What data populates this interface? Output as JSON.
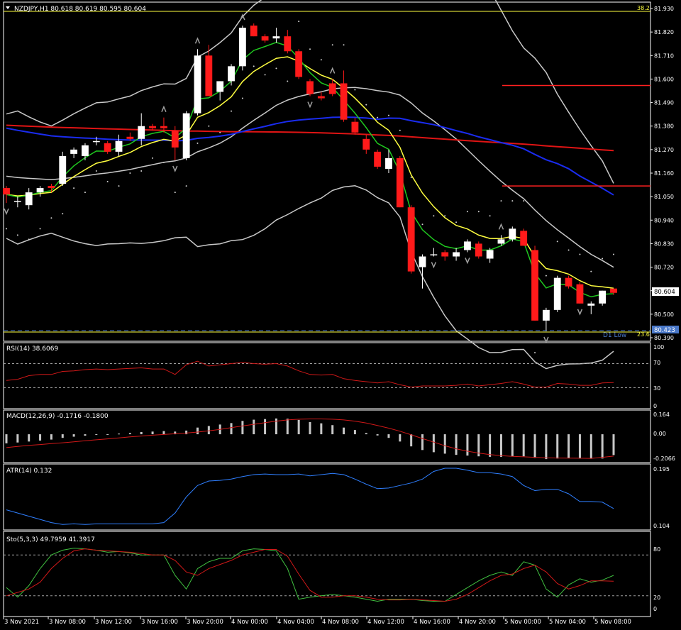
{
  "colors": {
    "bg": "#000000",
    "frame": "#ffffff",
    "text": "#ffffff",
    "bull": "#ffffff",
    "bear": "#ff1a1a",
    "ema_fast": "#1fc81f",
    "ema_slow": "#ffff40",
    "sma_blue": "#1a2cf0",
    "sma_red": "#e01414",
    "bands": "#c8c8c8",
    "psar": "#d0d0d0",
    "fib": "#ffff40",
    "resist": "#ff2020",
    "low_line": "#4a78c8",
    "rsi": "#d01818",
    "macd_hist": "#c8c8c8",
    "macd_signal": "#d01818",
    "atr": "#2f7fff",
    "sto_main": "#40c040",
    "sto_signal": "#d01818",
    "level_dash": "#a0a0a0",
    "price_tag_bg": "#ffffff",
    "low_tag_bg": "#4a78c8"
  },
  "main": {
    "header": "NZDJPY,H1  80.618 80.619 80.595 80.604",
    "price_ticks": [
      "81.930",
      "81.820",
      "81.710",
      "81.600",
      "81.490",
      "81.380",
      "81.270",
      "81.160",
      "81.050",
      "80.940",
      "80.830",
      "80.720",
      "80.610",
      "80.500",
      "80.390"
    ],
    "current_price": "80.604",
    "low_price": "80.423",
    "low_label": "D1 Low",
    "fib_top_label": "38.2",
    "fib_bottom_label": "23.6"
  },
  "rsi": {
    "label": "RSI(14) 38.6069",
    "scale": [
      "100",
      "70",
      "30",
      "0"
    ]
  },
  "macd": {
    "label": "MACD(12,26,9) -0.1716 -0.1800",
    "scale": [
      "0.164",
      "0.00",
      "-0.2066"
    ]
  },
  "atr": {
    "label": "ATR(14) 0.132",
    "scale": [
      "0.195",
      "0.104"
    ]
  },
  "sto": {
    "label": "Sto(5,3,3) 49.7959 41.3917",
    "scale": [
      "80",
      "20",
      "0"
    ]
  },
  "time_axis": [
    "3 Nov 2021",
    "3 Nov 08:00",
    "3 Nov 12:00",
    "3 Nov 16:00",
    "3 Nov 20:00",
    "4 Nov 00:00",
    "4 Nov 04:00",
    "4 Nov 08:00",
    "4 Nov 12:00",
    "4 Nov 16:00",
    "4 Nov 20:00",
    "5 Nov 00:00",
    "5 Nov 04:00",
    "5 Nov 08:00"
  ],
  "chart_data": [
    {
      "type": "candlestick",
      "title": "NZDJPY,H1",
      "ylim": [
        80.39,
        81.95
      ],
      "candles": [
        [
          81.09,
          81.1,
          81.02,
          81.06
        ],
        [
          81.03,
          81.05,
          81.0,
          81.03
        ],
        [
          81.01,
          81.09,
          80.99,
          81.07
        ],
        [
          81.07,
          81.1,
          81.05,
          81.09
        ],
        [
          81.1,
          81.11,
          81.07,
          81.09
        ],
        [
          81.11,
          81.26,
          81.1,
          81.24
        ],
        [
          81.25,
          81.28,
          81.23,
          81.27
        ],
        [
          81.24,
          81.3,
          81.22,
          81.29
        ],
        [
          81.31,
          81.33,
          81.29,
          81.31
        ],
        [
          81.3,
          81.31,
          81.25,
          81.26
        ],
        [
          81.26,
          81.34,
          81.24,
          81.31
        ],
        [
          81.33,
          81.35,
          81.31,
          81.32
        ],
        [
          81.32,
          81.44,
          81.29,
          81.38
        ],
        [
          81.38,
          81.39,
          81.36,
          81.37
        ],
        [
          81.38,
          81.42,
          81.35,
          81.37
        ],
        [
          81.36,
          81.38,
          81.22,
          81.28
        ],
        [
          81.23,
          81.45,
          81.22,
          81.44
        ],
        [
          81.44,
          81.74,
          81.43,
          81.71
        ],
        [
          81.71,
          81.76,
          81.52,
          81.52
        ],
        [
          81.54,
          81.59,
          81.5,
          81.59
        ],
        [
          81.59,
          81.67,
          81.57,
          81.66
        ],
        [
          81.66,
          81.85,
          81.64,
          81.84
        ],
        [
          81.85,
          81.86,
          81.8,
          81.8
        ],
        [
          81.8,
          81.81,
          81.77,
          81.78
        ],
        [
          81.79,
          81.84,
          81.77,
          81.8
        ],
        [
          81.8,
          81.83,
          81.72,
          81.73
        ],
        [
          81.73,
          81.74,
          81.6,
          81.61
        ],
        [
          81.59,
          81.6,
          81.52,
          81.53
        ],
        [
          81.52,
          81.54,
          81.5,
          81.51
        ],
        [
          81.58,
          81.6,
          81.52,
          81.53
        ],
        [
          81.58,
          81.64,
          81.4,
          81.41
        ],
        [
          81.4,
          81.42,
          81.34,
          81.35
        ],
        [
          81.32,
          81.34,
          81.25,
          81.27
        ],
        [
          81.26,
          81.27,
          81.18,
          81.19
        ],
        [
          81.18,
          81.27,
          81.16,
          81.23
        ],
        [
          81.23,
          81.24,
          81.0,
          81.0
        ],
        [
          81.0,
          81.01,
          80.69,
          80.7
        ],
        [
          80.72,
          80.78,
          80.62,
          80.77
        ],
        [
          80.78,
          80.81,
          80.77,
          80.78
        ],
        [
          80.79,
          80.8,
          80.75,
          80.77
        ],
        [
          80.77,
          80.81,
          80.75,
          80.79
        ],
        [
          80.8,
          80.85,
          80.79,
          80.84
        ],
        [
          80.83,
          80.84,
          80.76,
          80.77
        ],
        [
          80.76,
          80.81,
          80.74,
          80.8
        ],
        [
          80.83,
          80.87,
          80.82,
          80.85
        ],
        [
          80.85,
          80.91,
          80.84,
          80.9
        ],
        [
          80.89,
          80.9,
          80.82,
          80.82
        ],
        [
          80.8,
          80.82,
          80.47,
          80.47
        ],
        [
          80.47,
          80.53,
          80.42,
          80.52
        ],
        [
          80.52,
          80.68,
          80.51,
          80.67
        ],
        [
          80.67,
          80.68,
          80.62,
          80.63
        ],
        [
          80.64,
          80.65,
          80.55,
          80.55
        ],
        [
          80.54,
          80.56,
          80.5,
          80.55
        ],
        [
          80.55,
          80.61,
          80.54,
          80.61
        ],
        [
          80.62,
          80.62,
          80.59,
          80.6
        ]
      ]
    },
    {
      "type": "line",
      "title": "RSI(14)",
      "ylim": [
        0,
        100
      ],
      "values": [
        42,
        44,
        50,
        52,
        52,
        57,
        58,
        60,
        61,
        60,
        61,
        62,
        63,
        61,
        61,
        52,
        68,
        74,
        66,
        68,
        70,
        72,
        70,
        69,
        70,
        66,
        58,
        52,
        51,
        52,
        45,
        42,
        40,
        38,
        40,
        35,
        31,
        33,
        33,
        33,
        34,
        36,
        33,
        35,
        37,
        40,
        36,
        31,
        31,
        37,
        36,
        34,
        34,
        38,
        38.6
      ]
    },
    {
      "type": "bar",
      "title": "MACD(12,26,9)",
      "ylim": [
        -0.21,
        0.17
      ],
      "histogram": [
        -0.075,
        -0.068,
        -0.06,
        -0.052,
        -0.044,
        -0.03,
        -0.02,
        -0.012,
        -0.005,
        0.0,
        0.005,
        0.01,
        0.018,
        0.022,
        0.026,
        0.022,
        0.03,
        0.055,
        0.068,
        0.08,
        0.092,
        0.11,
        0.12,
        0.125,
        0.13,
        0.128,
        0.118,
        0.1,
        0.09,
        0.075,
        0.055,
        0.035,
        0.01,
        -0.01,
        -0.03,
        -0.06,
        -0.1,
        -0.13,
        -0.148,
        -0.16,
        -0.17,
        -0.176,
        -0.182,
        -0.186,
        -0.186,
        -0.184,
        -0.182,
        -0.195,
        -0.205,
        -0.2,
        -0.198,
        -0.2,
        -0.202,
        -0.2,
        -0.1716
      ],
      "signal": [
        -0.11,
        -0.1,
        -0.092,
        -0.085,
        -0.077,
        -0.07,
        -0.062,
        -0.054,
        -0.046,
        -0.038,
        -0.03,
        -0.022,
        -0.015,
        -0.008,
        -0.002,
        0.004,
        0.01,
        0.018,
        0.028,
        0.04,
        0.055,
        0.068,
        0.082,
        0.095,
        0.108,
        0.118,
        0.124,
        0.126,
        0.126,
        0.124,
        0.118,
        0.108,
        0.092,
        0.072,
        0.05,
        0.025,
        -0.005,
        -0.035,
        -0.065,
        -0.095,
        -0.12,
        -0.14,
        -0.155,
        -0.168,
        -0.176,
        -0.182,
        -0.186,
        -0.19,
        -0.194,
        -0.196,
        -0.197,
        -0.198,
        -0.199,
        -0.19,
        -0.18
      ]
    },
    {
      "type": "line",
      "title": "ATR(14)",
      "ylim": [
        0.104,
        0.195
      ],
      "values": [
        0.13,
        0.125,
        0.12,
        0.115,
        0.11,
        0.107,
        0.108,
        0.107,
        0.108,
        0.108,
        0.108,
        0.108,
        0.108,
        0.108,
        0.11,
        0.125,
        0.15,
        0.168,
        0.175,
        0.176,
        0.178,
        0.182,
        0.185,
        0.186,
        0.185,
        0.185,
        0.186,
        0.183,
        0.185,
        0.187,
        0.185,
        0.178,
        0.17,
        0.163,
        0.164,
        0.168,
        0.172,
        0.178,
        0.19,
        0.195,
        0.195,
        0.192,
        0.188,
        0.188,
        0.186,
        0.182,
        0.168,
        0.16,
        0.162,
        0.162,
        0.155,
        0.143,
        0.143,
        0.142,
        0.132
      ]
    },
    {
      "type": "line",
      "title": "Sto(5,3,3)",
      "ylim": [
        0,
        100
      ],
      "series": [
        {
          "values": [
            32,
            18,
            35,
            60,
            80,
            87,
            90,
            89,
            87,
            84,
            85,
            83,
            80,
            80,
            80,
            50,
            30,
            60,
            70,
            75,
            75,
            86,
            89,
            88,
            86,
            60,
            15,
            18,
            20,
            22,
            20,
            18,
            15,
            12,
            15,
            15,
            15,
            13,
            12,
            12,
            22,
            32,
            42,
            50,
            55,
            50,
            70,
            65,
            30,
            18,
            36,
            45,
            40,
            43,
            50
          ]
        },
        {
          "values": [
            20,
            25,
            30,
            40,
            60,
            75,
            86,
            89,
            87,
            86,
            85,
            84,
            82,
            80,
            80,
            72,
            55,
            50,
            60,
            66,
            72,
            80,
            84,
            88,
            88,
            78,
            52,
            28,
            18,
            18,
            20,
            20,
            18,
            15,
            14,
            14,
            15,
            14,
            13,
            12,
            15,
            22,
            32,
            42,
            50,
            52,
            60,
            65,
            55,
            38,
            30,
            35,
            42,
            42,
            41.4
          ]
        }
      ]
    }
  ]
}
